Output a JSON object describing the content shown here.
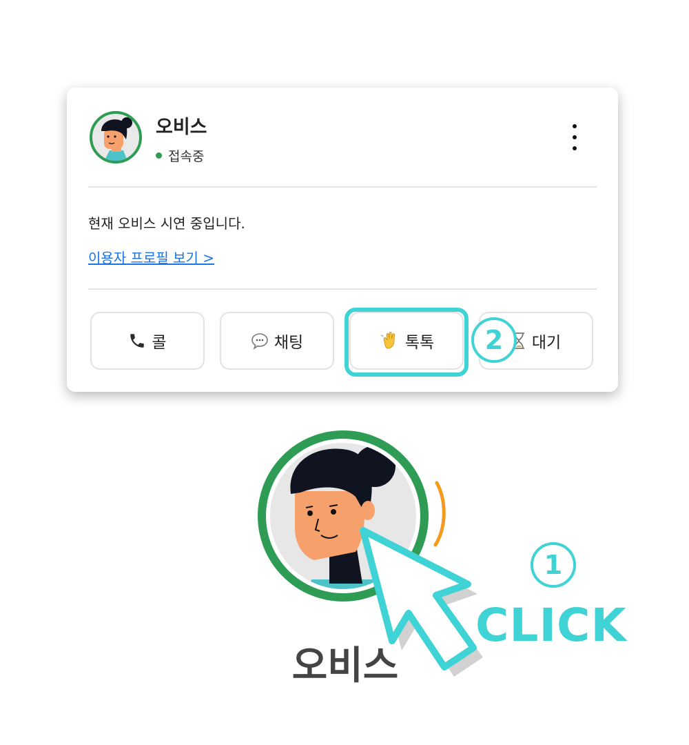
{
  "profile": {
    "name": "오비스",
    "status": "접속중",
    "message": "현재 오비스 시연 중입니다.",
    "profile_link": "이용자 프로필 보기 >"
  },
  "actions": [
    {
      "label": "콜",
      "icon": "phone-icon"
    },
    {
      "label": "채팅",
      "icon": "chat-bubble-icon"
    },
    {
      "label": "톡톡",
      "icon": "waving-hand-icon"
    },
    {
      "label": "대기",
      "icon": "hourglass-icon"
    }
  ],
  "annotations": {
    "step1": "1",
    "step2": "2",
    "click": "CLICK"
  },
  "big_name": "오비스",
  "colors": {
    "accent": "#3fd3d6",
    "online": "#2e9c55",
    "ring": "#2e9c55",
    "arc": "#f29b1d",
    "link": "#1a73e8"
  }
}
